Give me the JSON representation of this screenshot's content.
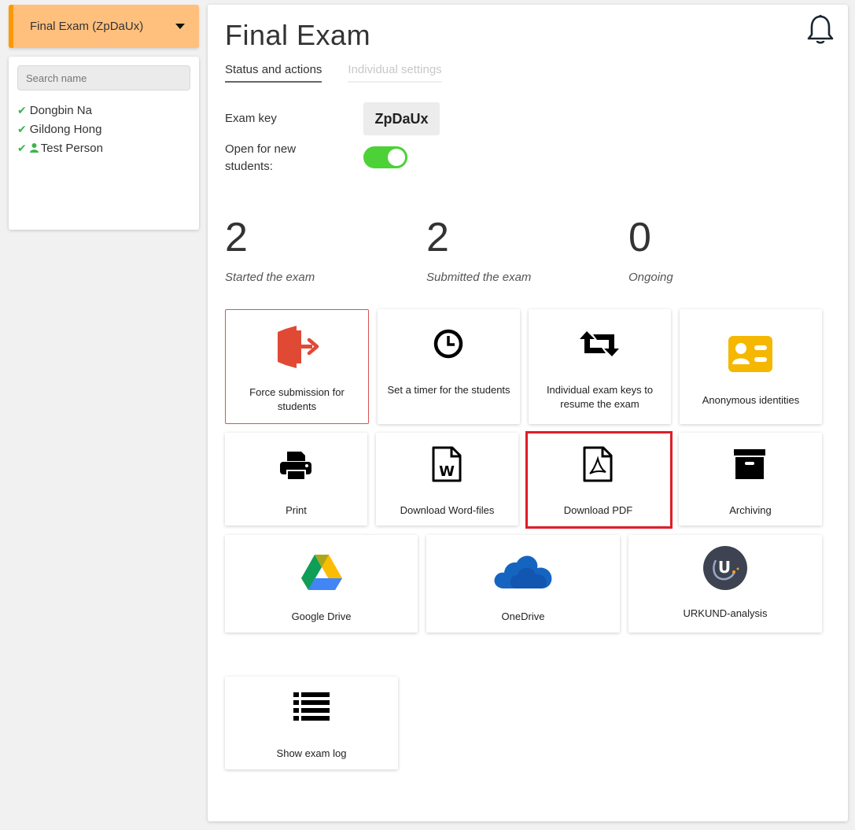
{
  "sidebar": {
    "exam_selector": "Final Exam (ZpDaUx)",
    "search_placeholder": "Search name",
    "students": [
      {
        "name": "Dongbin Na",
        "is_test": false
      },
      {
        "name": "Gildong Hong",
        "is_test": false
      },
      {
        "name": "Test Person",
        "is_test": true
      }
    ]
  },
  "main": {
    "title": "Final Exam",
    "tabs": [
      {
        "label": "Status and actions",
        "active": true
      },
      {
        "label": "Individual settings",
        "active": false
      }
    ],
    "exam_key_label": "Exam key",
    "exam_key": "ZpDaUx",
    "open_label": "Open for new students:",
    "open_for_new_students": true,
    "stats": [
      {
        "value": "2",
        "label": "Started the exam"
      },
      {
        "value": "2",
        "label": "Submitted the exam"
      },
      {
        "value": "0",
        "label": "Ongoing"
      }
    ],
    "actions": {
      "force_submission": "Force submission for students",
      "set_timer": "Set a timer for the students",
      "individual_keys": "Individual exam keys to resume the exam",
      "anonymous": "Anonymous identities",
      "print": "Print",
      "download_word": "Download Word-files",
      "download_pdf": "Download PDF",
      "archiving": "Archiving",
      "google_drive": "Google Drive",
      "onedrive": "OneDrive",
      "urkund": "URKUND-analysis",
      "exam_log": "Show exam log"
    }
  },
  "colors": {
    "accent_orange": "#ff9800",
    "selector_bg": "#ffc07e",
    "toggle_green": "#4cd137",
    "check_green": "#3cb54a",
    "danger_red": "#d9534f",
    "highlight_red": "#e01e27",
    "anonymous_yellow": "#f5b700"
  }
}
